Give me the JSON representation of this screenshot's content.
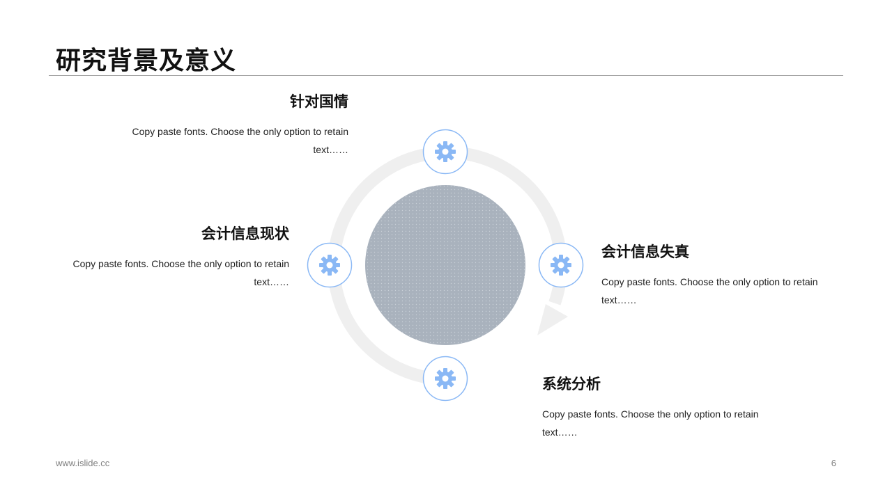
{
  "slide": {
    "title": "研究背景及意义",
    "footer_url": "www.islide.cc",
    "page_number": "6"
  },
  "colors": {
    "accent": "#8ab8f5",
    "ring": "#efefef",
    "center_fill": "#a9b2bd",
    "title_rule": "#a6a6a6"
  },
  "items": [
    {
      "heading": "针对国情",
      "body": "Copy paste fonts. Choose the only option to retain text……",
      "icon": "gear-icon"
    },
    {
      "heading": "会计信息现状",
      "body": "Copy paste fonts. Choose the only option to retain text……",
      "icon": "gear-icon"
    },
    {
      "heading": "会计信息失真",
      "body": "Copy paste fonts. Choose the only option to retain text……",
      "icon": "gear-icon"
    },
    {
      "heading": "系统分析",
      "body": "Copy paste fonts. Choose the only option to retain text……",
      "icon": "gear-icon"
    }
  ]
}
